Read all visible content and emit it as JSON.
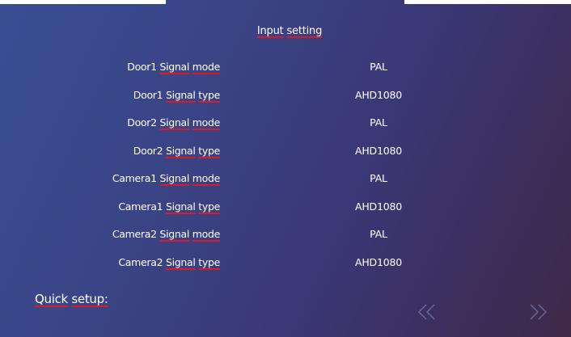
{
  "title": {
    "prefix": "Input",
    "word": "setting"
  },
  "settings": [
    {
      "device": "Door1",
      "param_a": "Signal",
      "param_b": "mode",
      "value": "PAL"
    },
    {
      "device": "Door1",
      "param_a": "Signal",
      "param_b": "type",
      "value": "AHD1080"
    },
    {
      "device": "Door2",
      "param_a": "Signal",
      "param_b": "mode",
      "value": "PAL"
    },
    {
      "device": "Door2",
      "param_a": "Signal",
      "param_b": "type",
      "value": "AHD1080"
    },
    {
      "device": "Camera1",
      "param_a": "Signal",
      "param_b": "mode",
      "value": "PAL"
    },
    {
      "device": "Camera1",
      "param_a": "Signal",
      "param_b": "type",
      "value": "AHD1080"
    },
    {
      "device": "Camera2",
      "param_a": "Signal",
      "param_b": "mode",
      "value": "PAL"
    },
    {
      "device": "Camera2",
      "param_a": "Signal",
      "param_b": "type",
      "value": "AHD1080"
    }
  ],
  "quick_setup": {
    "word1": "Quick",
    "word2": "setup:"
  },
  "nav": {
    "prev_icon": "double-left-arrow-icon",
    "next_icon": "double-right-arrow-icon"
  },
  "colors": {
    "background_start": "#3a4e93",
    "background_end": "#3f2a48",
    "text": "#ffffff",
    "underline": "#d81b25",
    "arrow_icon": "#6d6a96"
  }
}
